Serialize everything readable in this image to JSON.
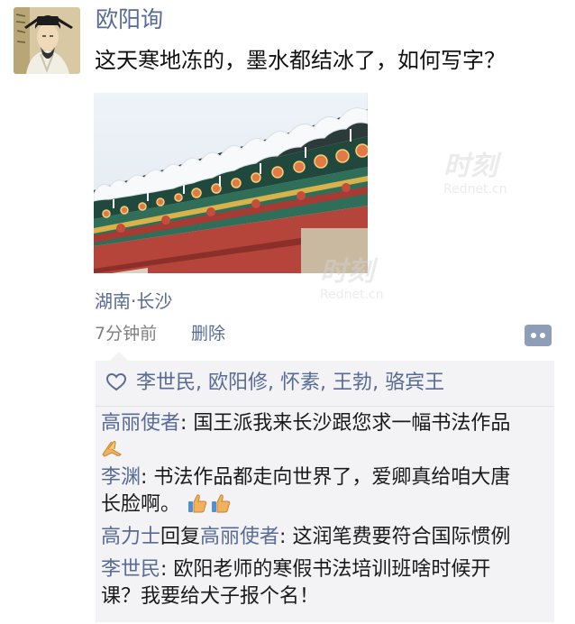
{
  "post": {
    "author": "欧阳询",
    "text": "这天寒地冻的，墨水都结冰了，如何写字？",
    "location": "湖南·长沙",
    "time": "7分钟前",
    "delete_label": "删除"
  },
  "watermark": {
    "brand": "时刻",
    "url": "Rednet.cn"
  },
  "likes": [
    {
      "name": "李世民",
      "sep": ","
    },
    {
      "name": "欧阳修",
      "sep": ","
    },
    {
      "name": "怀素",
      "sep": ","
    },
    {
      "name": "王勃",
      "sep": ","
    },
    {
      "name": "骆宾王",
      "sep": ""
    }
  ],
  "comments": [
    {
      "from": "高丽使者",
      "text": ": 国王派我来长沙跟您求一幅书法作品",
      "emoji": "folded-hands"
    },
    {
      "from": "李渊",
      "text": ": 书法作品都走向世界了，爱卿真给咱大唐",
      "line2": "长脸啊。",
      "emoji": "thumbs-up-x2"
    },
    {
      "from": "高力士",
      "reply_word": "回复",
      "to": "高丽使者",
      "text": ": 这润笔费要符合国际惯例"
    },
    {
      "from": "李世民",
      "text": ": 欧阳老师的寒假书法培训班啥时候开",
      "line2": "课？我要给犬子报个名！"
    }
  ],
  "colors": {
    "name_blue": "#576b95",
    "panel_bg": "#f3f3f5",
    "more_btn": "#8e9db8"
  },
  "icons": [
    "avatar-portrait",
    "heart-icon",
    "more-icon",
    "folded-hands-emoji",
    "thumbs-up-emoji"
  ]
}
